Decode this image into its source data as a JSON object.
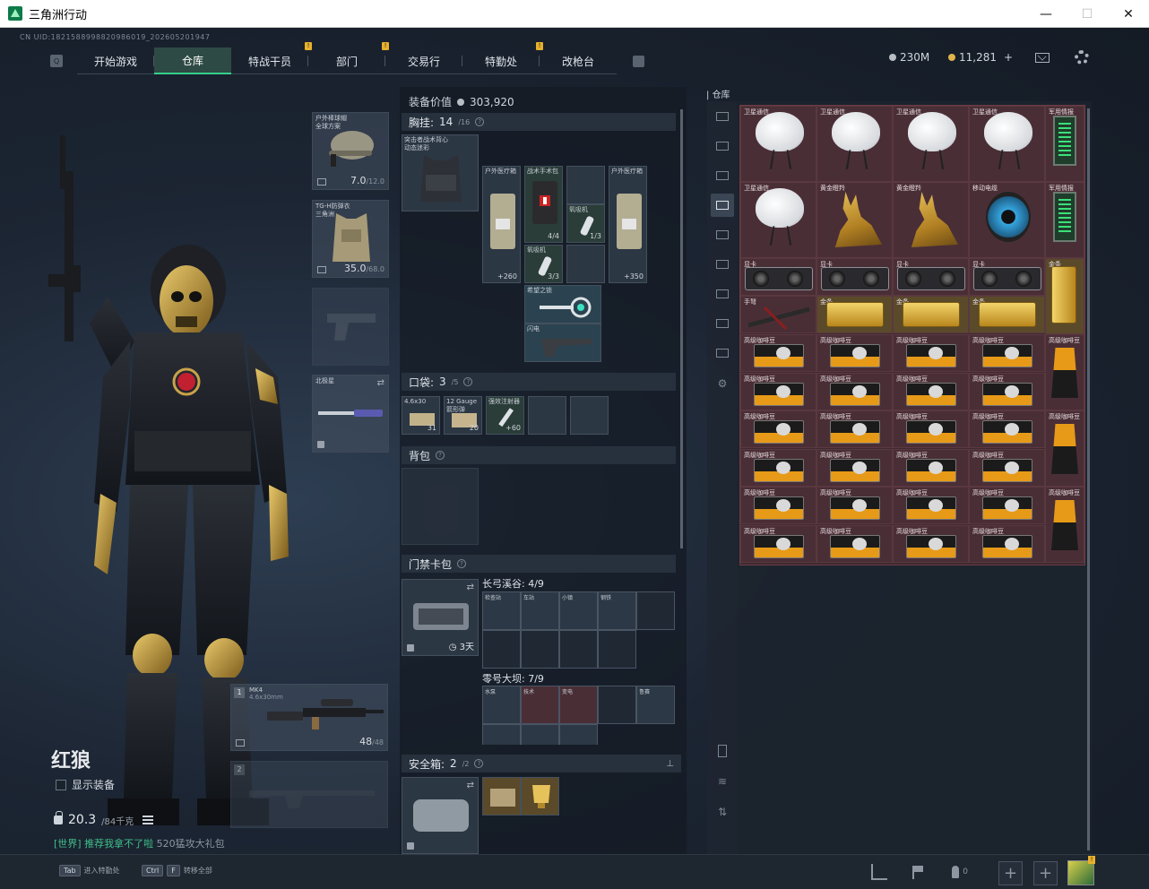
{
  "window": {
    "title": "三角洲行动",
    "minimize": "—",
    "maximize": "☐",
    "close": "✕"
  },
  "uid": "CN UID:1821588998820986019_202605201947",
  "nav": {
    "tabs": [
      {
        "label": "开始游戏",
        "badge": ""
      },
      {
        "label": "仓库",
        "badge": ""
      },
      {
        "label": "特战干员",
        "badge": "!"
      },
      {
        "label": "部门",
        "badge": "!"
      },
      {
        "label": "交易行",
        "badge": ""
      },
      {
        "label": "特勤处",
        "badge": "!"
      },
      {
        "label": "改枪台",
        "badge": ""
      }
    ]
  },
  "currency": {
    "silver": "230M",
    "gold": "11,281",
    "gold_plus": "+"
  },
  "character": {
    "name": "红狼",
    "show_gear_label": "显示装备",
    "weight": "20.3",
    "weight_max": "/84千克",
    "world_msg_prefix": "[世界] 推荐我拿不了啦",
    "world_msg_suffix": "520猛攻大礼包"
  },
  "equip": {
    "helmet": {
      "label": "户外棒球帽\n全球方案",
      "value": "7.0",
      "max": "/12.0"
    },
    "armor": {
      "label": "TG-H防弹衣\n三角洲",
      "value": "35.0",
      "max": "/68.0"
    },
    "melee": {
      "label": "北极星"
    },
    "primary": {
      "slot": "1",
      "label": "MK4",
      "sub": "4.6x30mm",
      "ammo": "48",
      "ammo_max": "/48"
    },
    "secondary": {
      "slot": "2"
    }
  },
  "loadout": {
    "equip_value_label": "装备价值",
    "equip_value": "303,920",
    "chest": {
      "title": "胸挂:",
      "count": "14",
      "max": "/16"
    },
    "pocket": {
      "title": "口袋:",
      "count": "3",
      "max": "/5"
    },
    "backpack": {
      "title": "背包"
    },
    "keycase": {
      "title": "门禁卡包"
    },
    "safebox": {
      "title": "安全箱:",
      "count": "2",
      "max": "/2"
    },
    "chest_items": [
      {
        "label": "突击者战术背心\n动态迷彩"
      },
      {
        "label": "户外医疗箱",
        "cnt": "+260"
      },
      {
        "label": "战术手术包",
        "cnt": "4/4"
      },
      {
        "label": "",
        "cnt": ""
      },
      {
        "label": "户外医疗箱",
        "cnt": "+350"
      },
      {
        "label": "氧吸机",
        "cnt": "1/3"
      },
      {
        "label": "氧吸机",
        "cnt": "3/3"
      },
      {
        "label": "希望之锁"
      },
      {
        "label": "闪电"
      }
    ],
    "pocket_items": [
      {
        "label": "4.6x30",
        "cnt": "31"
      },
      {
        "label": "12 Gauge\n箭形弹",
        "cnt": "20"
      },
      {
        "label": "强效注射器",
        "cnt": "+60"
      }
    ],
    "keycase_timer": "3天",
    "map1": "长弓溪谷: 4/9",
    "map1_keys": [
      "检查站",
      "车站",
      "小镇",
      "钢铁"
    ],
    "map2": "零号大坝: 7/9",
    "map2_keys": [
      "水泵",
      "技术",
      "变电",
      "",
      "",
      "鲁赛"
    ]
  },
  "warehouse": {
    "title": "仓库",
    "items": {
      "satellite": "卫星通信",
      "military_intel": "军用情报",
      "golden_deer": "黄金瞪羚",
      "cable_reel": "移动电缆",
      "gpu": "显卡",
      "gold_bar": "金条",
      "crossbow": "手弩",
      "coffee": "高级咖啡豆"
    }
  },
  "bottom": {
    "hint1_key": "Tab",
    "hint1": "进入特勤处",
    "hint2_key1": "Ctrl",
    "hint2_key2": "F",
    "hint2": "转移全部",
    "friends": "0",
    "avatar_badge": "!"
  }
}
